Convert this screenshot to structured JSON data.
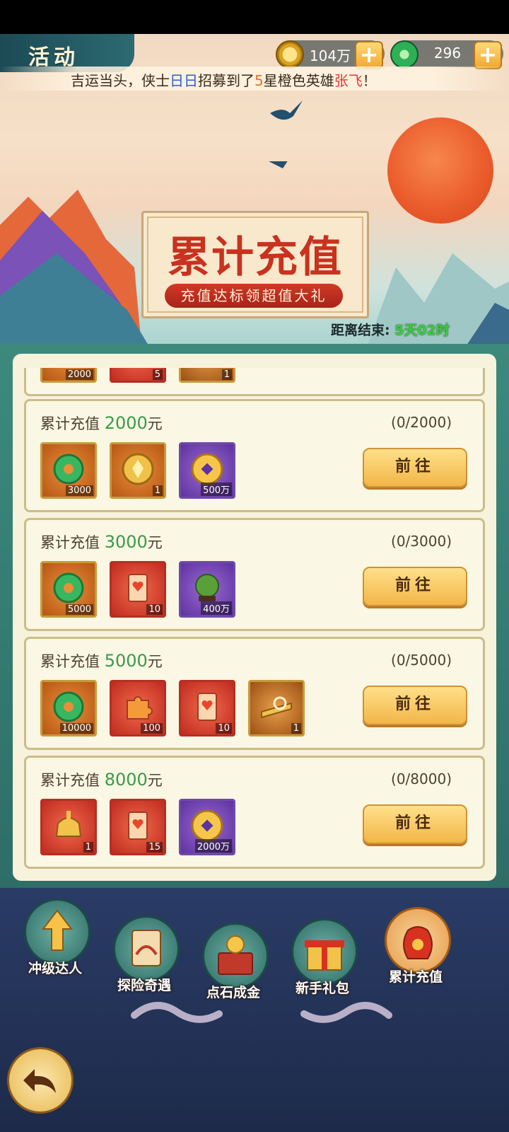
{
  "header": {
    "title": "活动",
    "coins": {
      "value": "104万",
      "icon": "copper-coin-icon"
    },
    "jade": {
      "value": "296",
      "icon": "jade-icon"
    },
    "plus_label": "+"
  },
  "ticker": {
    "part1": "吉运当头，侠士",
    "player": "日日",
    "part2": "招募到了",
    "star": "5",
    "part3": "星橙色英雄",
    "hero": "张飞",
    "part4": "！"
  },
  "banner": {
    "title": "累计充值",
    "subtitle": "充值达标领超值大礼",
    "countdown_label": "距离结束:",
    "countdown_value": "5天02时"
  },
  "rewards": [
    {
      "label": "累计充值",
      "amount": "2000",
      "unit": "元",
      "progress": "(0/2000)",
      "button": "前往",
      "items": [
        {
          "icon": "jade-icon",
          "qty": "3000",
          "bg": "orange"
        },
        {
          "icon": "gold-shield-icon",
          "qty": "1",
          "bg": "orange"
        },
        {
          "icon": "copper-coin-icon",
          "qty": "500万",
          "bg": "purple"
        }
      ]
    },
    {
      "label": "累计充值",
      "amount": "3000",
      "unit": "元",
      "progress": "(0/3000)",
      "button": "前往",
      "items": [
        {
          "icon": "jade-icon",
          "qty": "5000",
          "bg": "orange"
        },
        {
          "icon": "scroll-icon",
          "qty": "10",
          "bg": "red"
        },
        {
          "icon": "green-orb-icon",
          "qty": "400万",
          "bg": "purple"
        }
      ]
    },
    {
      "label": "累计充值",
      "amount": "5000",
      "unit": "元",
      "progress": "(0/5000)",
      "button": "前往",
      "items": [
        {
          "icon": "jade-icon",
          "qty": "10000",
          "bg": "orange"
        },
        {
          "icon": "puzzle-piece-icon",
          "qty": "100",
          "bg": "red"
        },
        {
          "icon": "scroll-icon",
          "qty": "10",
          "bg": "red"
        },
        {
          "icon": "gold-badge-icon",
          "qty": "1",
          "bg": "gold"
        }
      ]
    },
    {
      "label": "累计充值",
      "amount": "8000",
      "unit": "元",
      "progress": "(0/8000)",
      "button": "前往",
      "items": [
        {
          "icon": "gold-helmet-icon",
          "qty": "1",
          "bg": "red"
        },
        {
          "icon": "scroll-icon",
          "qty": "15",
          "bg": "red"
        },
        {
          "icon": "copper-coin-icon",
          "qty": "2000万",
          "bg": "purple"
        }
      ]
    }
  ],
  "partial_card": {
    "items": [
      {
        "icon": "jade-icon",
        "qty": "2000",
        "bg": "orange"
      },
      {
        "icon": "scroll-icon",
        "qty": "5",
        "bg": "red"
      },
      {
        "icon": "gold-badge-icon",
        "qty": "1",
        "bg": "gold"
      }
    ]
  },
  "nav": [
    {
      "label": "冲级达人",
      "icon": "level-up-arrow-icon"
    },
    {
      "label": "探险奇遇",
      "icon": "treasure-map-icon"
    },
    {
      "label": "点石成金",
      "icon": "gold-chest-icon"
    },
    {
      "label": "新手礼包",
      "icon": "gift-box-icon"
    },
    {
      "label": "累计充值",
      "icon": "money-bag-icon"
    }
  ],
  "back_icon": "back-arrow-icon"
}
